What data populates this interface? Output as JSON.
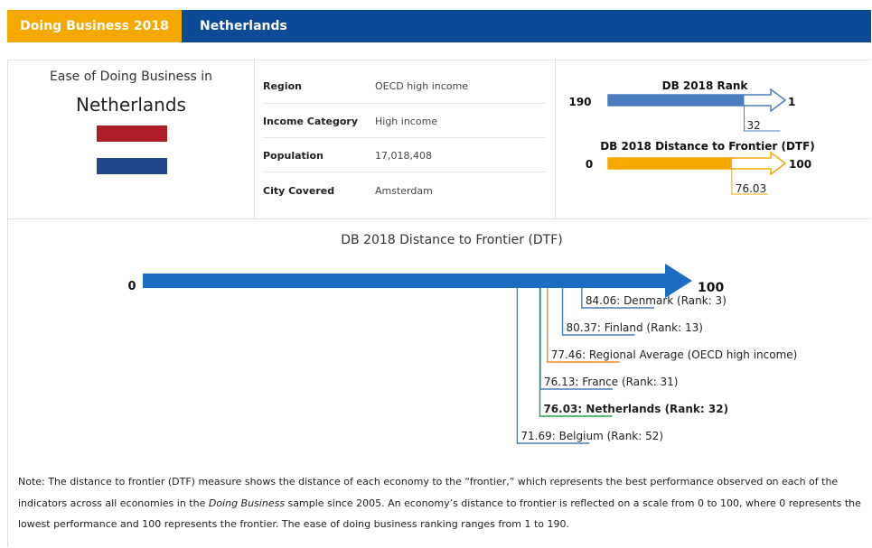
{
  "header": {
    "tab_active": "Doing Business 2018",
    "tab_country": "Netherlands"
  },
  "profile": {
    "ease_label": "Ease of Doing Business in",
    "country": "Netherlands",
    "flag_colors": [
      "#ae1c28",
      "#ffffff",
      "#21468b"
    ],
    "info": [
      {
        "key": "Region",
        "value": "OECD high income"
      },
      {
        "key": "Income Category",
        "value": "High income"
      },
      {
        "key": "Population",
        "value": "17,018,408"
      },
      {
        "key": "City Covered",
        "value": "Amsterdam"
      }
    ]
  },
  "rank_box": {
    "title": "DB 2018 Rank",
    "start": "190",
    "end": "1",
    "value": 32,
    "value_label": "32",
    "color": "#4a7cc0"
  },
  "dtf_box": {
    "title": "DB 2018 Distance to Frontier (DTF)",
    "start": "0",
    "end": "100",
    "value": 76.03,
    "value_label": "76.03",
    "color": "#f5a800"
  },
  "chart_data": {
    "type": "bar",
    "title": "DB 2018 Distance to Frontier (DTF)",
    "axis_start": "0",
    "axis_end": "100",
    "xlim": [
      0,
      100
    ],
    "bar_color": "#1b6dc1",
    "entries": [
      {
        "label": "84.06: Denmark (Rank: 3)",
        "value": 84.06,
        "color": "#4a7cc0",
        "bold": false
      },
      {
        "label": "80.37: Finland (Rank: 13)",
        "value": 80.37,
        "color": "#4a7cc0",
        "bold": false
      },
      {
        "label": "77.46: Regional Average (OECD high income)",
        "value": 77.46,
        "color": "#f08c1e",
        "bold": false
      },
      {
        "label": "76.13: France (Rank: 31)",
        "value": 76.13,
        "color": "#4a7cc0",
        "bold": false
      },
      {
        "label": "76.03: Netherlands (Rank: 32)",
        "value": 76.03,
        "color": "#2e9e4f",
        "bold": true
      },
      {
        "label": "71.69: Belgium (Rank: 52)",
        "value": 71.69,
        "color": "#4a7cc0",
        "bold": false
      }
    ]
  },
  "note": {
    "prefix": "Note: The distance to frontier (DTF) measure shows the distance of each economy to the “frontier,” which represents the best performance observed on each of the indicators across all economies in the ",
    "italic": "Doing Business",
    "suffix": " sample since 2005. An economy’s distance to frontier is reflected on a scale from 0 to 100, where 0 represents the lowest performance and 100 represents the frontier. The ease of doing business ranking ranges from 1 to 190."
  }
}
